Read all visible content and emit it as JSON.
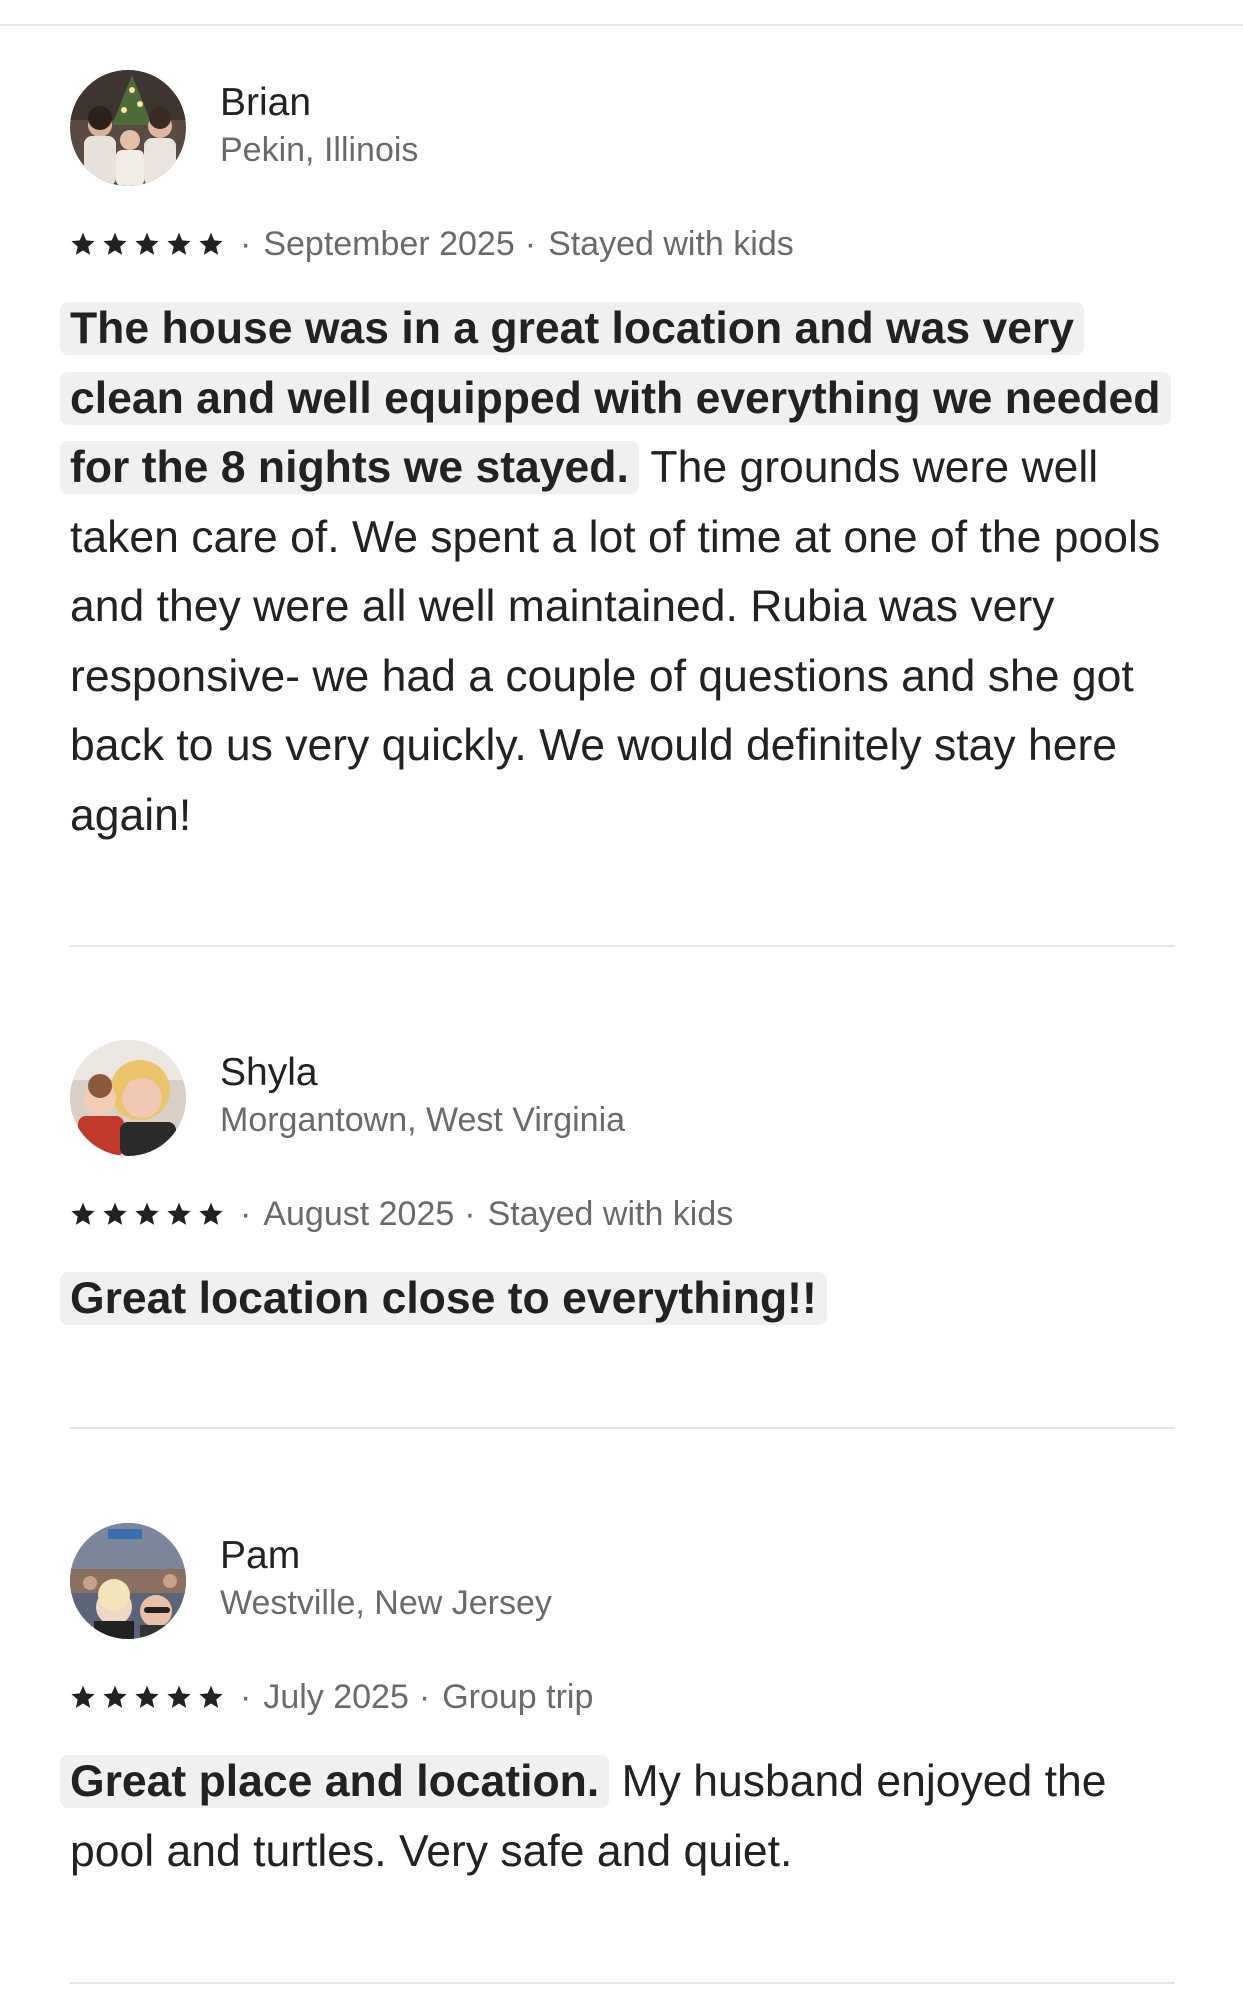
{
  "reviews": [
    {
      "name": "Brian",
      "location": "Pekin, Illinois",
      "rating": 5,
      "date": "September 2025",
      "trip_type": "Stayed with kids",
      "highlight": "The house was in a great location and was very clean and well equipped with everything we needed for the 8 nights we stayed.",
      "text": " The grounds were well taken care of.  We spent a lot of time at one of the pools and they were all well maintained.  Rubia was very responsive- we had a couple of questions and she got back to us very quickly.  We would definitely stay here again!",
      "avatar_icon": "family-photo-avatar"
    },
    {
      "name": "Shyla",
      "location": "Morgantown, West Virginia",
      "rating": 5,
      "date": "August 2025",
      "trip_type": "Stayed with kids",
      "highlight": "Great location close to everything!!",
      "text": "",
      "avatar_icon": "mother-child-photo-avatar"
    },
    {
      "name": "Pam",
      "location": "Westville, New Jersey",
      "rating": 5,
      "date": "July 2025",
      "trip_type": "Group trip",
      "highlight": "Great place and location.",
      "text": "  My husband enjoyed the pool and turtles.  Very safe and quiet.",
      "avatar_icon": "selfie-photo-avatar"
    }
  ],
  "separator": "·",
  "colors": {
    "text_primary": "#222222",
    "text_secondary": "#6a6a6a",
    "highlight_bg": "#f0f0f0",
    "divider": "#e4e4e4"
  }
}
